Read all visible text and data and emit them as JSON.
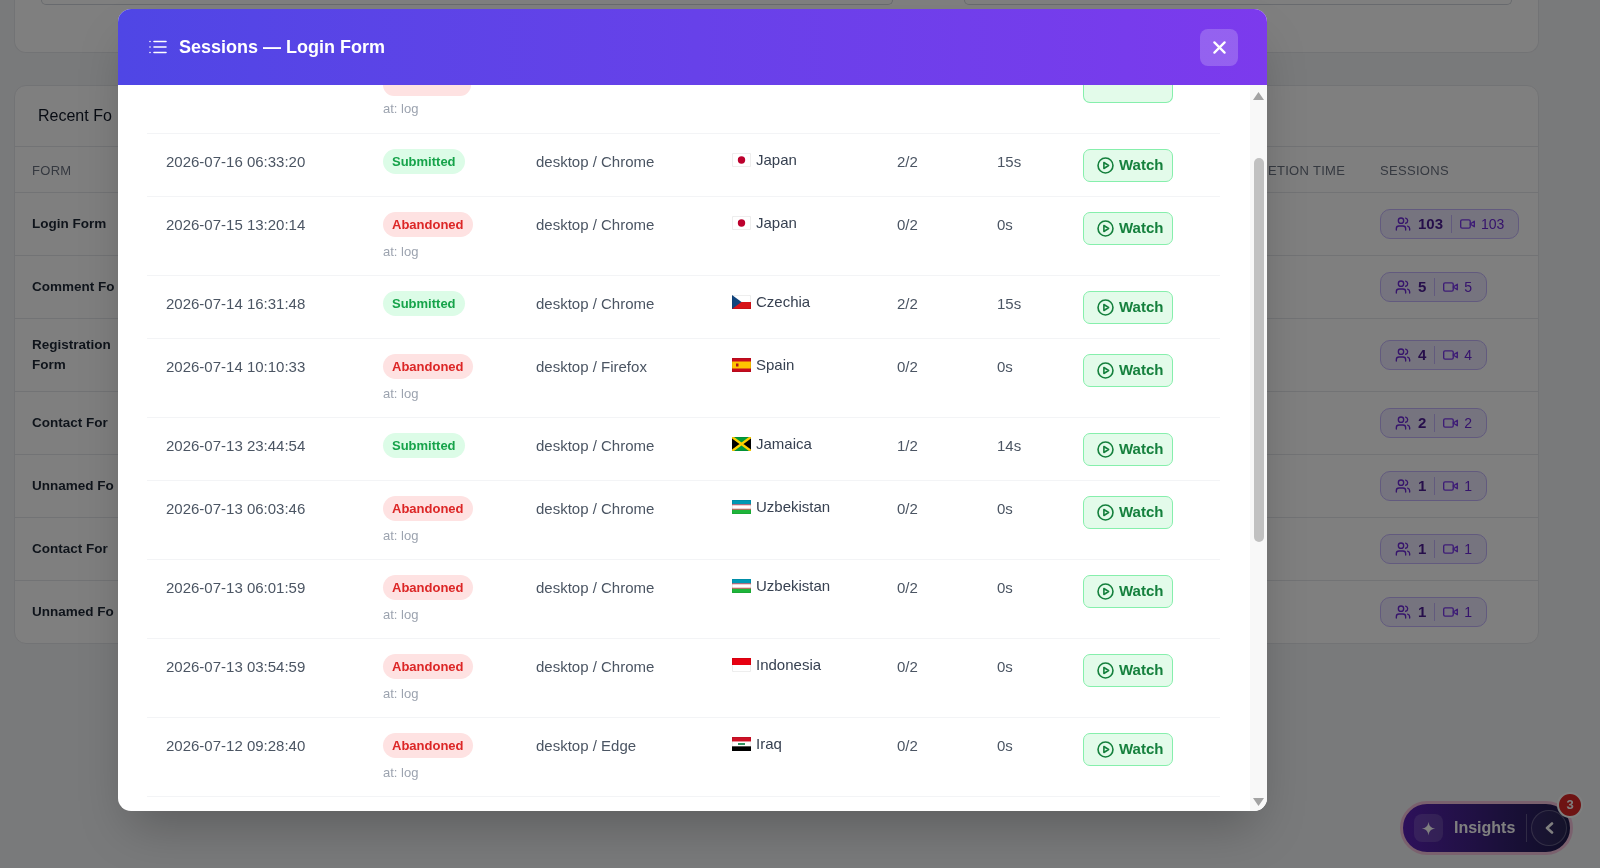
{
  "page": {
    "recent_forms": {
      "title": "Recent Fo",
      "columns": [
        "FORM",
        "ETION TIME",
        "SESSIONS"
      ],
      "rows": [
        {
          "form": "Login Form",
          "visitors": "103",
          "recordings": "103"
        },
        {
          "form": "Comment Fo",
          "visitors": "5",
          "recordings": "5"
        },
        {
          "form": "Registration Form",
          "visitors": "4",
          "recordings": "4"
        },
        {
          "form": "Contact For",
          "visitors": "2",
          "recordings": "2"
        },
        {
          "form": "Unnamed Fo",
          "visitors": "1",
          "recordings": "1"
        },
        {
          "form": "Contact For",
          "visitors": "1",
          "recordings": "1"
        },
        {
          "form": "Unnamed Fo",
          "visitors": "1",
          "recordings": "1"
        }
      ]
    },
    "insights": {
      "label": "Insights",
      "count": "3"
    }
  },
  "modal": {
    "title": "Sessions — Login Form",
    "partial_row": {
      "status": {
        "kind": "abandoned",
        "note": "at: log"
      }
    },
    "rows": [
      {
        "time": "2026-07-16 06:33:20",
        "status": {
          "kind": "submitted",
          "label": "Submitted"
        },
        "device": "desktop / Chrome",
        "location": {
          "kind": "japan",
          "country": "Japan"
        },
        "fields": "2/2",
        "duration": "15s",
        "action": "Watch"
      },
      {
        "time": "2026-07-15 13:20:14",
        "status": {
          "kind": "abandoned",
          "label": "Abandoned",
          "note": "at: log"
        },
        "device": "desktop / Chrome",
        "location": {
          "kind": "japan",
          "country": "Japan"
        },
        "fields": "0/2",
        "duration": "0s",
        "action": "Watch"
      },
      {
        "time": "2026-07-14 16:31:48",
        "status": {
          "kind": "submitted",
          "label": "Submitted"
        },
        "device": "desktop / Chrome",
        "location": {
          "kind": "czechia",
          "country": "Czechia"
        },
        "fields": "2/2",
        "duration": "15s",
        "action": "Watch"
      },
      {
        "time": "2026-07-14 10:10:33",
        "status": {
          "kind": "abandoned",
          "label": "Abandoned",
          "note": "at: log"
        },
        "device": "desktop / Firefox",
        "location": {
          "kind": "spain",
          "country": "Spain"
        },
        "fields": "0/2",
        "duration": "0s",
        "action": "Watch"
      },
      {
        "time": "2026-07-13 23:44:54",
        "status": {
          "kind": "submitted",
          "label": "Submitted"
        },
        "device": "desktop / Chrome",
        "location": {
          "kind": "jamaica",
          "country": "Jamaica"
        },
        "fields": "1/2",
        "duration": "14s",
        "action": "Watch"
      },
      {
        "time": "2026-07-13 06:03:46",
        "status": {
          "kind": "abandoned",
          "label": "Abandoned",
          "note": "at: log"
        },
        "device": "desktop / Chrome",
        "location": {
          "kind": "uzbekistan",
          "country": "Uzbekistan"
        },
        "fields": "0/2",
        "duration": "0s",
        "action": "Watch"
      },
      {
        "time": "2026-07-13 06:01:59",
        "status": {
          "kind": "abandoned",
          "label": "Abandoned",
          "note": "at: log"
        },
        "device": "desktop / Chrome",
        "location": {
          "kind": "uzbekistan",
          "country": "Uzbekistan"
        },
        "fields": "0/2",
        "duration": "0s",
        "action": "Watch"
      },
      {
        "time": "2026-07-13 03:54:59",
        "status": {
          "kind": "abandoned",
          "label": "Abandoned",
          "note": "at: log"
        },
        "device": "desktop / Chrome",
        "location": {
          "kind": "indonesia",
          "country": "Indonesia"
        },
        "fields": "0/2",
        "duration": "0s",
        "action": "Watch"
      },
      {
        "time": "2026-07-12 09:28:40",
        "status": {
          "kind": "abandoned",
          "label": "Abandoned",
          "note": "at: log"
        },
        "device": "desktop / Edge",
        "location": {
          "kind": "iraq",
          "country": "Iraq"
        },
        "fields": "0/2",
        "duration": "0s",
        "action": "Watch"
      }
    ]
  }
}
